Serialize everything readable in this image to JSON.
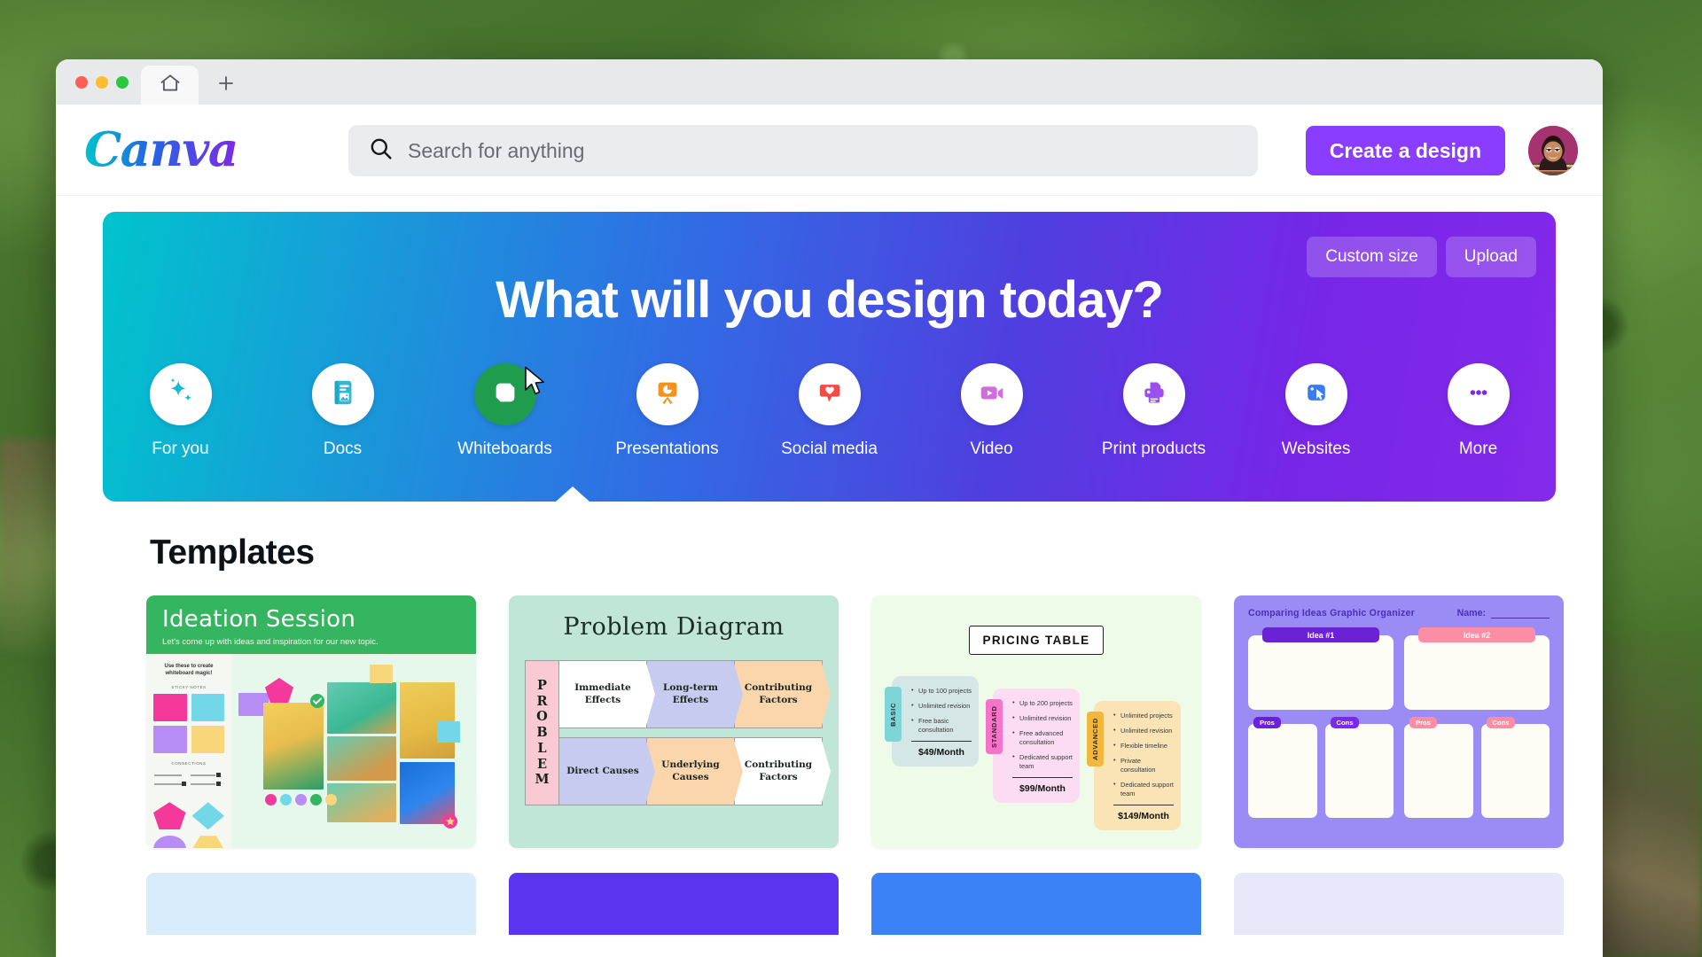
{
  "window": {
    "traffic_lights": [
      "close",
      "minimize",
      "maximize"
    ],
    "tab_icon": "home-icon",
    "new_tab_label": "+"
  },
  "header": {
    "logo_text": "Canva",
    "search": {
      "placeholder": "Search for anything",
      "value": "",
      "icon": "search-icon"
    },
    "create_button": "Create a design",
    "avatar_name": "account-avatar"
  },
  "banner": {
    "title": "What will you design today?",
    "actions": [
      {
        "label": "Custom size",
        "name": "custom-size-button"
      },
      {
        "label": "Upload",
        "name": "upload-button"
      }
    ],
    "categories": [
      {
        "label": "For you",
        "icon": "sparkle-icon",
        "color": "#19b9d1",
        "active": false
      },
      {
        "label": "Docs",
        "icon": "document-icon",
        "color": "#2cb9d8",
        "active": false
      },
      {
        "label": "Whiteboards",
        "icon": "whiteboard-icon",
        "color": "#ffffff",
        "active": true
      },
      {
        "label": "Presentations",
        "icon": "presentation-icon",
        "color": "#f59219",
        "active": false
      },
      {
        "label": "Social media",
        "icon": "heart-post-icon",
        "color": "#f54b45",
        "active": false
      },
      {
        "label": "Video",
        "icon": "video-camera-icon",
        "color": "#d16be0",
        "active": false
      },
      {
        "label": "Print products",
        "icon": "printer-icon",
        "color": "#9b4ff0",
        "active": false
      },
      {
        "label": "Websites",
        "icon": "website-icon",
        "color": "#3b7bf0",
        "active": false
      },
      {
        "label": "More",
        "icon": "ellipsis-icon",
        "color": "#7a2ae8",
        "active": false
      }
    ],
    "gradient_from": "#00c4cc",
    "gradient_to": "#8329ea"
  },
  "templates": {
    "heading": "Templates",
    "cards": [
      {
        "name": "ideation-session",
        "title": "Ideation Session",
        "subtitle": "Let's come up with ideas and inspiration for our new topic.",
        "sidebar_note": "Use these to create whiteboard magic!",
        "section_stickies": "STICKY NOTES",
        "section_connections": "CONNECTIONS",
        "accent": "#35b55f",
        "background": "#e6f8ec"
      },
      {
        "name": "problem-diagram",
        "title": "Problem Diagram",
        "spine": "PROBLEM",
        "row1": [
          "Immediate Effects",
          "Long-term Effects",
          "Contributing Factors"
        ],
        "row2": [
          "Direct Causes",
          "Underlying Causes",
          "Contributing Factors"
        ],
        "background": "#bfe6d7"
      },
      {
        "name": "pricing-table",
        "title": "PRICING TABLE",
        "background": "#eefbe9",
        "plans": [
          {
            "tag": "BASIC",
            "tag_color": "#7fd4d8",
            "card_color": "#d5e6e7",
            "features": [
              "Up to 100 projects",
              "Unlimited revision",
              "Free basic consultation"
            ],
            "price": "$49/Month"
          },
          {
            "tag": "STANDARD",
            "tag_color": "#f573c8",
            "card_color": "#fbdcf3",
            "features": [
              "Up to 200 projects",
              "Unlimited revision",
              "Free advanced consultation",
              "Dedicated support team"
            ],
            "price": "$99/Month"
          },
          {
            "tag": "ADVANCED",
            "tag_color": "#f2b73f",
            "card_color": "#fae3b4",
            "features": [
              "Unlimited projects",
              "Unlimited revision",
              "Flexible timeline",
              "Private consultation",
              "Dedicated support team"
            ],
            "price": "$149/Month"
          }
        ]
      },
      {
        "name": "comparing-ideas-graphic-organizer",
        "title": "Comparing Ideas Graphic Organizer",
        "name_label": "Name:",
        "background": "#9b8cf5",
        "columns": [
          {
            "heading": "Idea #1",
            "color": "#6b21d6",
            "pros": "Pros",
            "cons": "Cons"
          },
          {
            "heading": "Idea #2",
            "color": "#fb8da4",
            "pros": "Pros",
            "cons": "Cons"
          }
        ]
      }
    ],
    "next_row_colors": [
      "#d8ecfb",
      "#5b34ef",
      "#3b82f6",
      "#e8e8fb"
    ]
  }
}
